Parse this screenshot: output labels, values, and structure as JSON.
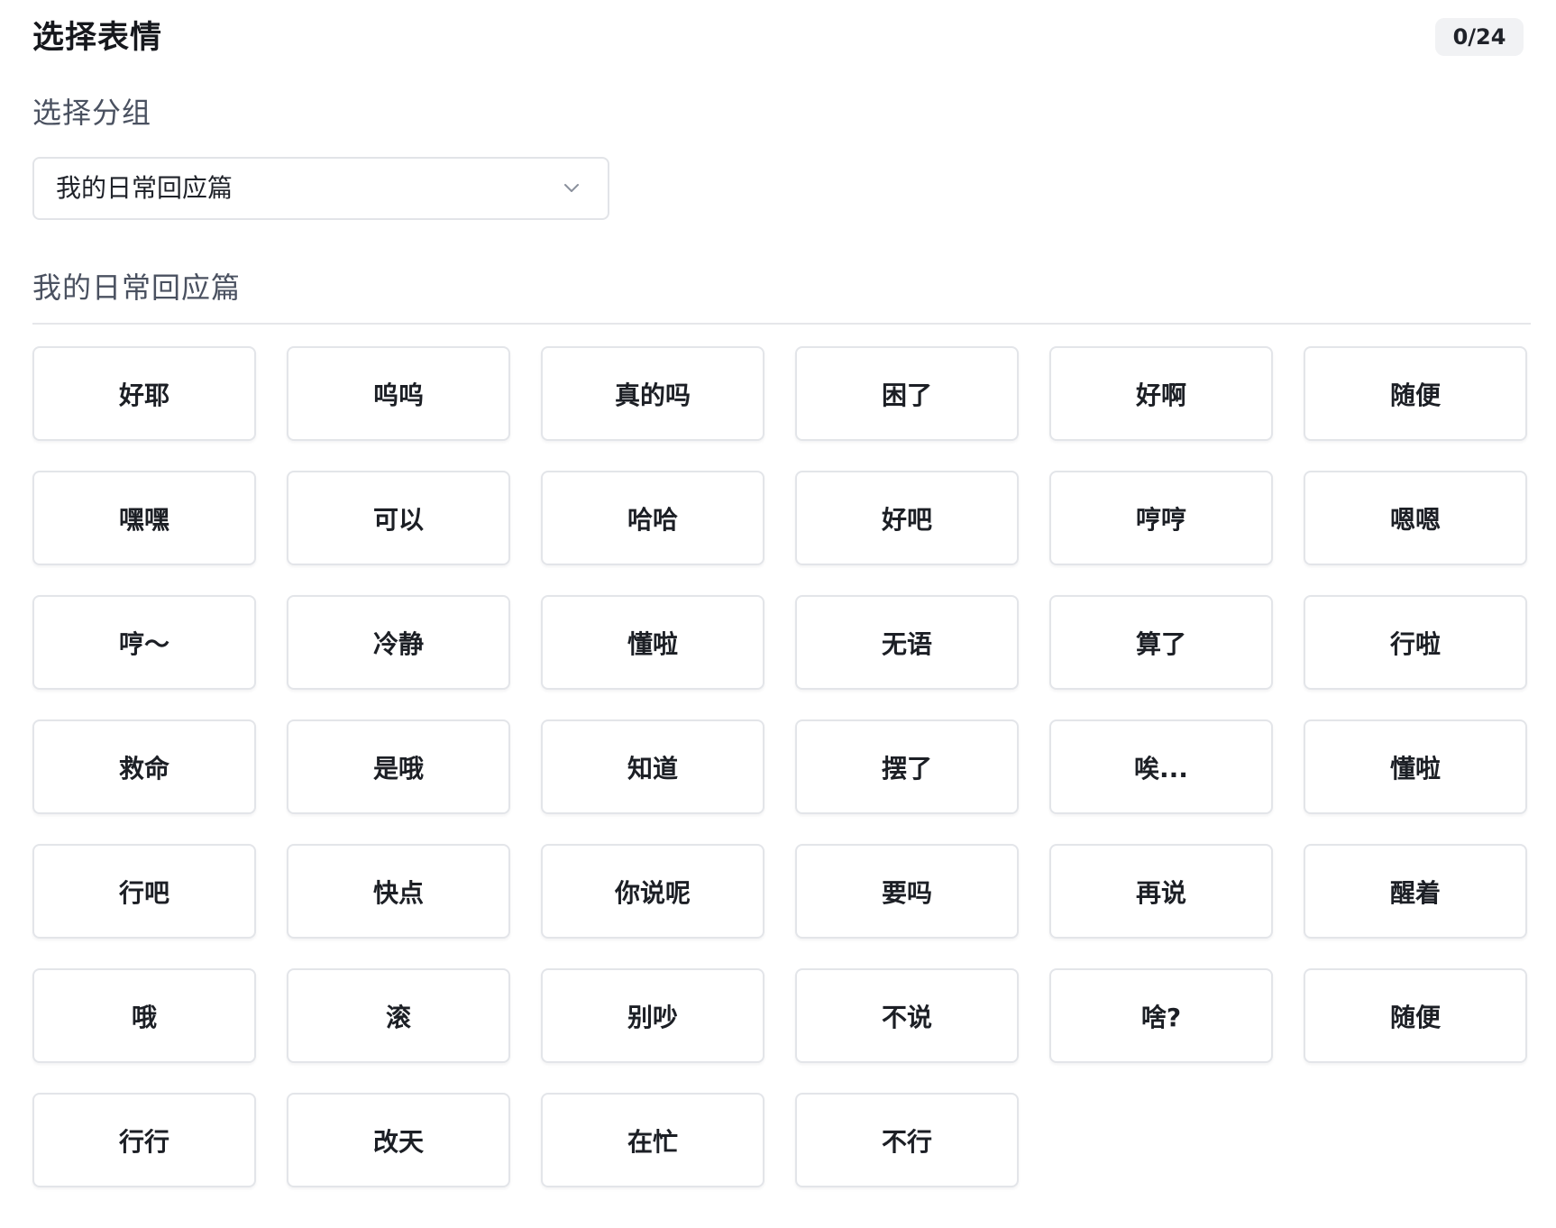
{
  "header": {
    "title": "选择表情",
    "counter": "0/24"
  },
  "group_select": {
    "label": "选择分组",
    "value": "我的日常回应篇",
    "icon": "chevron-down-icon"
  },
  "section": {
    "title": "我的日常回应篇"
  },
  "emojis": [
    "好耶",
    "呜呜",
    "真的吗",
    "困了",
    "好啊",
    "随便",
    "嘿嘿",
    "可以",
    "哈哈",
    "好吧",
    "哼哼",
    "嗯嗯",
    "哼～",
    "冷静",
    "懂啦",
    "无语",
    "算了",
    "行啦",
    "救命",
    "是哦",
    "知道",
    "摆了",
    "唉...",
    "懂啦",
    "行吧",
    "快点",
    "你说呢",
    "要吗",
    "再说",
    "醒着",
    "哦",
    "滚",
    "别吵",
    "不说",
    "啥?",
    "随便",
    "行行",
    "改天",
    "在忙",
    "不行"
  ],
  "colors": {
    "text_primary": "#1c1f25",
    "text_secondary": "#4a5160",
    "border": "#e3e5e9",
    "counter_bg": "#f1f2f4"
  }
}
